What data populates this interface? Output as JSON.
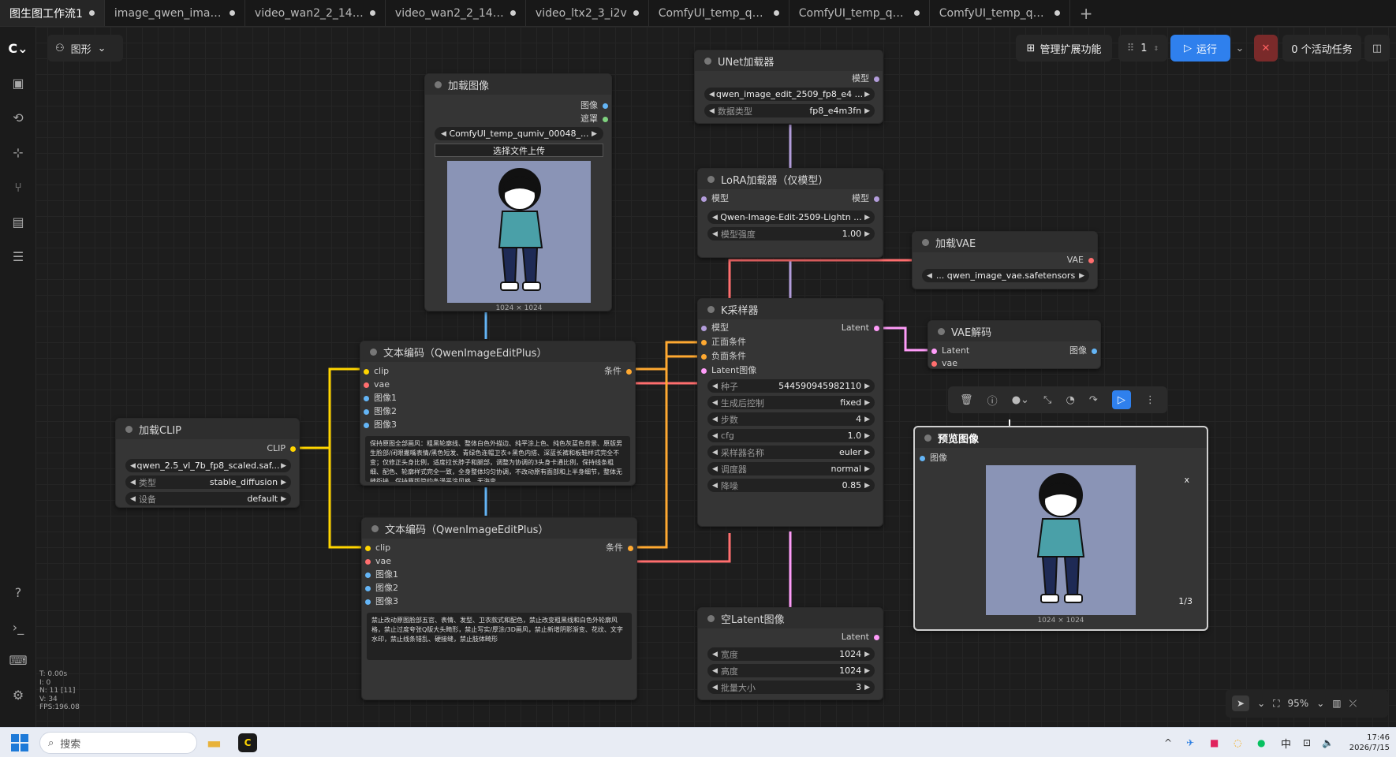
{
  "tabs": [
    {
      "label": "图生图工作流1",
      "active": true
    },
    {
      "label": "image_qwen_image...",
      "active": false
    },
    {
      "label": "video_wan2_2_14B_i...",
      "active": false
    },
    {
      "label": "video_wan2_2_14B_t...",
      "active": false
    },
    {
      "label": "video_ltx2_3_i2v",
      "active": false
    },
    {
      "label": "ComfyUI_temp_qum...",
      "active": false
    },
    {
      "label": "ComfyUI_temp_qum...",
      "active": false
    },
    {
      "label": "ComfyUI_temp_qum...",
      "active": false
    }
  ],
  "tab_add": "+",
  "graph_menu": {
    "label": "图形"
  },
  "toolbar": {
    "manage_extensions": "管理扩展功能",
    "queue_count": "1",
    "run_label": "运行",
    "cancel": "✕",
    "active_tasks": "0 个活动任务"
  },
  "nodes": {
    "load_image": {
      "title": "加载图像",
      "out_image": "图像",
      "out_mask": "遮罩",
      "file": "ComfyUI_temp_qumiv_00048_...",
      "upload": "选择文件上传",
      "size": "1024 × 1024"
    },
    "unet": {
      "title": "UNet加载器",
      "out_model": "模型",
      "name": "qwen_image_edit_2509_fp8_e4 ...",
      "dtype_label": "数据类型",
      "dtype": "fp8_e4m3fn"
    },
    "lora": {
      "title": "LoRA加载器（仅模型）",
      "in_model": "模型",
      "out_model": "模型",
      "name": "Qwen-Image-Edit-2509-Lightn ...",
      "strength_label": "模型强度",
      "strength": "1.00"
    },
    "vae_loader": {
      "title": "加载VAE",
      "out_vae": "VAE",
      "name": "... qwen_image_vae.safetensors"
    },
    "ksampler": {
      "title": "K采样器",
      "in_model": "模型",
      "in_pos": "正面条件",
      "in_neg": "负面条件",
      "in_latent": "Latent图像",
      "out_latent": "Latent",
      "seed_label": "种子",
      "seed": "544590945982110",
      "control_label": "生成后控制",
      "control": "fixed",
      "steps_label": "步数",
      "steps": "4",
      "cfg_label": "cfg",
      "cfg": "1.0",
      "sampler_label": "采样器名称",
      "sampler": "euler",
      "scheduler_label": "调度器",
      "scheduler": "normal",
      "denoise_label": "降噪",
      "denoise": "0.85"
    },
    "vae_decode": {
      "title": "VAE解码",
      "in_latent": "Latent",
      "in_vae": "vae",
      "out_image": "图像"
    },
    "text_encode_1": {
      "title": "文本编码（QwenImageEditPlus）",
      "in_clip": "clip",
      "in_vae": "vae",
      "in_img1": "图像1",
      "in_img2": "图像2",
      "in_img3": "图像3",
      "out_cond": "条件",
      "text": "保持原图全部画风：粗黑轮廓线、整体白色外描边、纯平涂上色、纯色灰蓝色背景、原版男生脸部/闭眼撇嘴表情/黑色短发、青绿色连帽卫衣+黑色内搭、深蓝长裤和板鞋样式完全不变；仅修正头身比例，适度拉长脖子和腿部，调整为协调的3头身卡通比例，保持线条粗细、配色、轮廓样式完全一致，全身整体均匀协调，不改动原有面部和上半身细节，整体无缝衔接，保持原版简约条漫平涂风格，无海变"
    },
    "text_encode_2": {
      "title": "文本编码（QwenImageEditPlus）",
      "in_clip": "clip",
      "in_vae": "vae",
      "in_img1": "图像1",
      "in_img2": "图像2",
      "in_img3": "图像3",
      "out_cond": "条件",
      "text": "禁止改动原图脸部五官、表情、发型、卫衣款式和配色，禁止改变粗黑线和白色外轮廓风格，禁止过度夸张Q版大头畸形，禁止写实/厚涂/3D画风，禁止新增阴影渐变、花纹、文字水印，禁止线条错乱、硬接缝，禁止肢体畸形"
    },
    "load_clip": {
      "title": "加载CLIP",
      "out_clip": "CLIP",
      "name": "qwen_2.5_vl_7b_fp8_scaled.saf...",
      "type_label": "类型",
      "type": "stable_diffusion",
      "device_label": "设备",
      "device": "default"
    },
    "empty_latent": {
      "title": "空Latent图像",
      "out_latent": "Latent",
      "width_label": "宽度",
      "width": "1024",
      "height_label": "高度",
      "height": "1024",
      "batch_label": "批量大小",
      "batch": "3"
    },
    "preview": {
      "title": "预览图像",
      "in_image": "图像",
      "close": "x",
      "counter": "1/3",
      "size": "1024 × 1024"
    }
  },
  "stats": {
    "t": "T: 0.00s",
    "i": "I: 0",
    "n": "N: 11 [11]",
    "v": "V: 34",
    "fps": "FPS:196.08"
  },
  "zoom": "95%",
  "taskbar": {
    "search_placeholder": "搜索",
    "ime": "中",
    "time": "17:46",
    "date": "2026/7/15"
  },
  "colors": {
    "model": "#b39ddb",
    "clip": "#ffd500",
    "vae": "#ff6e6e",
    "image": "#64b5f6",
    "latent": "#ff9cf9",
    "conditioning": "#ffa931",
    "accent": "#2f80ed"
  }
}
